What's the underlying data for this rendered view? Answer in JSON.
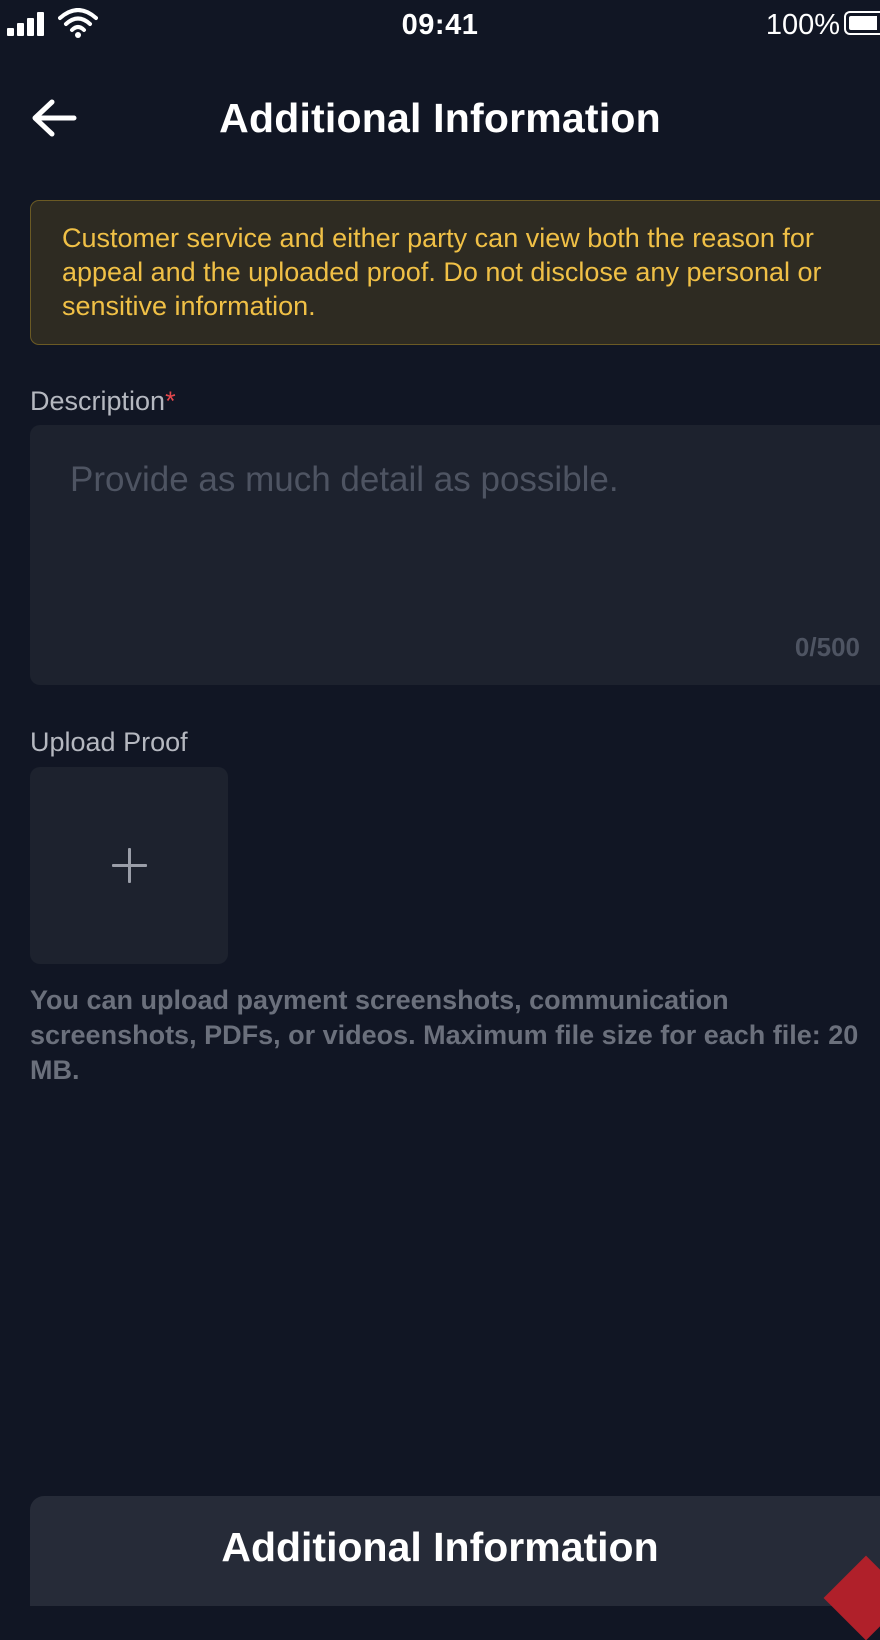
{
  "status_bar": {
    "time": "09:41",
    "battery": "100%",
    "signal_icon": "cellular-signal-icon",
    "wifi_icon": "wifi-icon",
    "battery_icon": "battery-icon"
  },
  "header": {
    "title": "Additional Information",
    "back_icon": "arrow-left-icon"
  },
  "notice": {
    "text": "Customer service and either party can view both the reason for appeal and the uploaded proof. Do not disclose any personal or sensitive information."
  },
  "description": {
    "label": "Description",
    "required_mark": "*",
    "placeholder": "Provide as much detail as possible.",
    "value": "",
    "counter": "0/500"
  },
  "upload": {
    "label": "Upload Proof",
    "add_icon": "plus-icon",
    "hint": "You can upload payment screenshots, communication screenshots, PDFs, or videos. Maximum file size for each file: 20 MB."
  },
  "footer": {
    "button_label": "Additional Information"
  },
  "colors": {
    "background": "#111624",
    "notice_text": "#f0c046",
    "notice_background": "#2e2b22",
    "required": "#e5484d",
    "field_background": "#1d222e",
    "button_background": "#262b38"
  }
}
